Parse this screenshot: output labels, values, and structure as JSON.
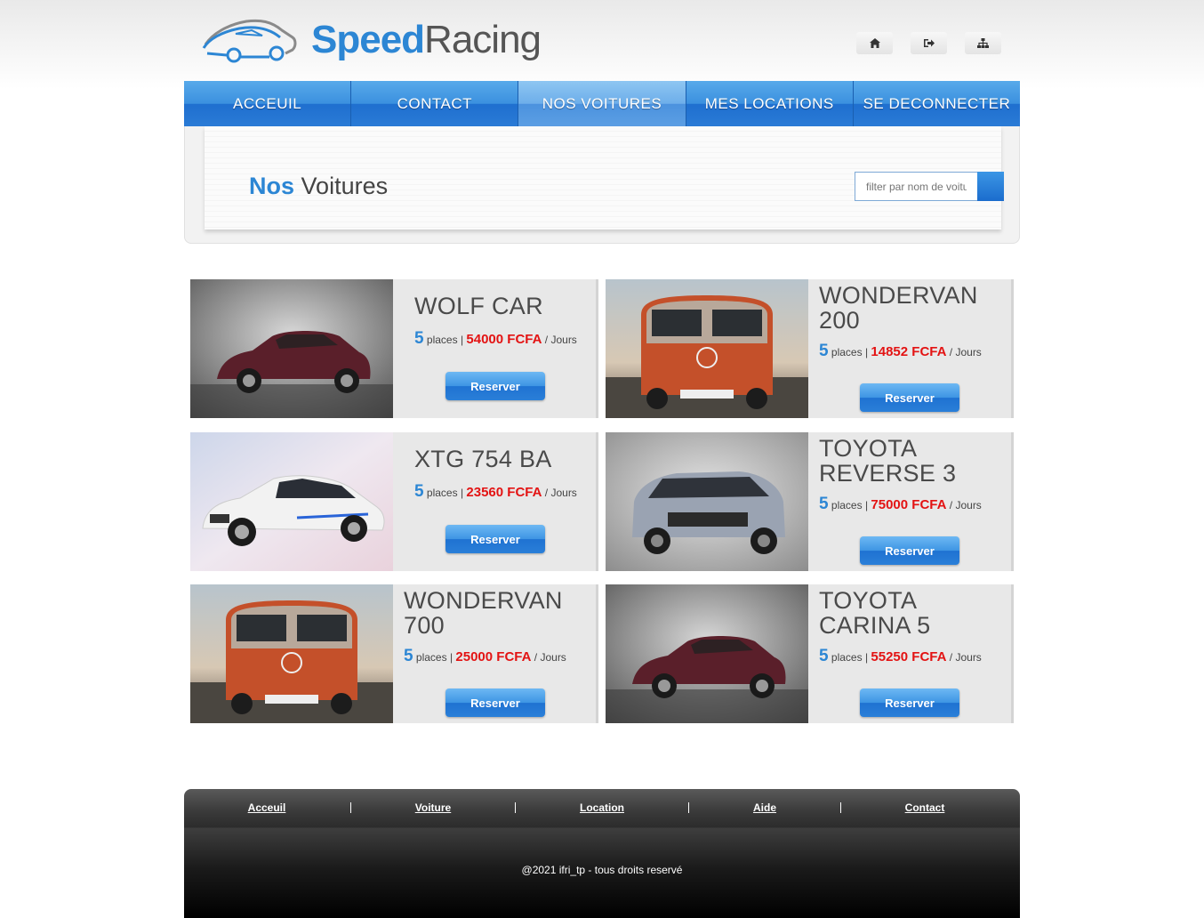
{
  "brand": {
    "word1": "Speed",
    "word2": "Racing"
  },
  "top_icons": [
    "home-icon",
    "sign-out-icon",
    "sitemap-icon"
  ],
  "nav": [
    {
      "label": "ACCEUIL",
      "active": false
    },
    {
      "label": "CONTACT",
      "active": false
    },
    {
      "label": "NOS VOITURES",
      "active": true
    },
    {
      "label": "MES LOCATIONS",
      "active": false
    },
    {
      "label": "SE DECONNECTER",
      "active": false
    }
  ],
  "page_title": {
    "highlight": "Nos",
    "rest": "Voitures"
  },
  "search": {
    "placeholder": "filter par nom de voiture"
  },
  "cars": [
    {
      "name": "Wolf car",
      "seats": "5",
      "seats_label": "places |",
      "price": "54000 FCFA",
      "per": "/ Jours",
      "button": "Reserver",
      "photo": "maroon-suv"
    },
    {
      "name": "wondervan 200",
      "seats": "5",
      "seats_label": "places |",
      "price": "14852 FCFA",
      "per": "/ Jours",
      "button": "Reserver",
      "photo": "orange-van"
    },
    {
      "name": "xtg 754 ba",
      "seats": "5",
      "seats_label": "places |",
      "price": "23560 FCFA",
      "per": "/ Jours",
      "button": "Reserver",
      "photo": "white-sedan"
    },
    {
      "name": "toyota reverse 3",
      "seats": "5",
      "seats_label": "places |",
      "price": "75000 FCFA",
      "per": "/ Jours",
      "button": "Reserver",
      "photo": "silver-suv"
    },
    {
      "name": "wondervan 700",
      "seats": "5",
      "seats_label": "places |",
      "price": "25000 FCFA",
      "per": "/ Jours",
      "button": "Reserver",
      "photo": "orange-van"
    },
    {
      "name": "toyota carina 5",
      "seats": "5",
      "seats_label": "places |",
      "price": "55250 FCFA",
      "per": "/ Jours",
      "button": "Reserver",
      "photo": "maroon-suv"
    }
  ],
  "footer": {
    "links": [
      "Acceuil",
      "Voiture",
      "Location",
      "Aide",
      "Contact"
    ],
    "copyright": "@2021 ifri_tp - tous droits reservé"
  },
  "colors": {
    "accent": "#2c86d4",
    "price": "#e31313"
  }
}
